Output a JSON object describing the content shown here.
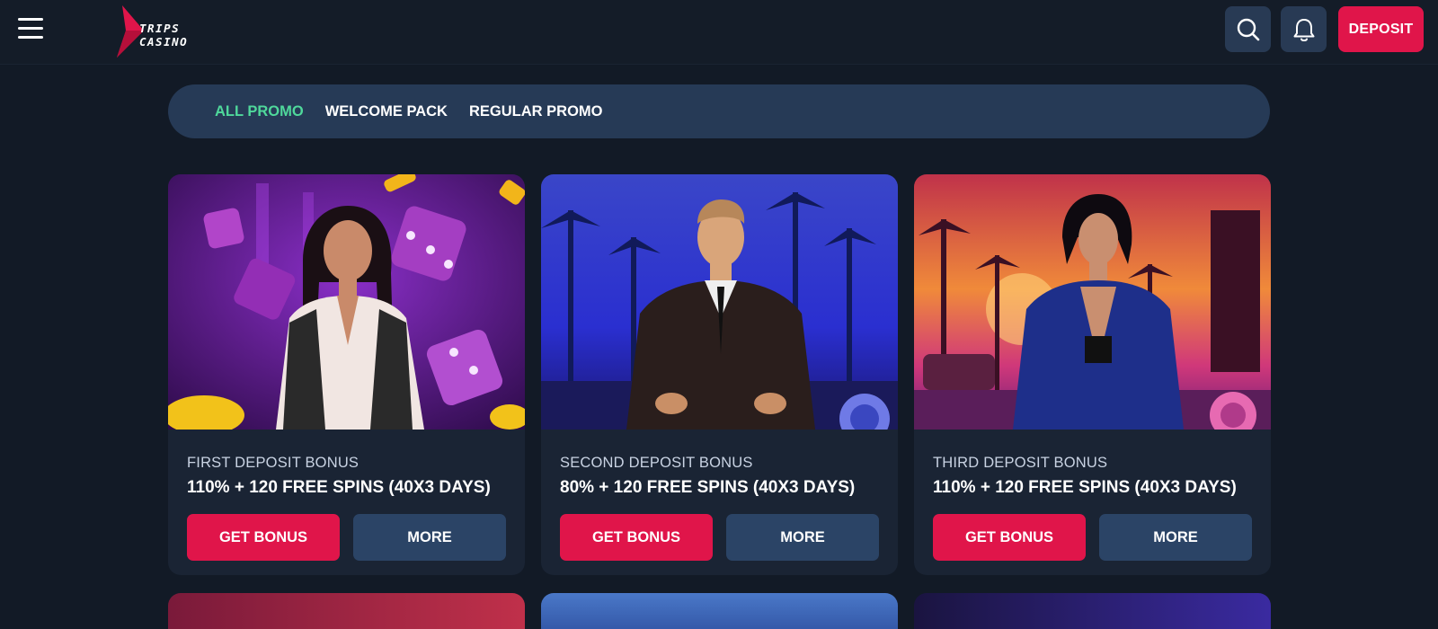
{
  "header": {
    "menu_icon": "hamburger-menu-icon",
    "logo_text_line1": "TRIPS",
    "logo_text_line2": "CASINO",
    "search_icon": "search-icon",
    "bell_icon": "bell-icon",
    "deposit_label": "DEPOSIT"
  },
  "filters": [
    {
      "label": "ALL PROMO",
      "active": true
    },
    {
      "label": "WELCOME PACK",
      "active": false
    },
    {
      "label": "REGULAR PROMO",
      "active": false
    }
  ],
  "cards": [
    {
      "subtitle": "FIRST DEPOSIT BONUS",
      "title": "110% + 120 FREE SPINS (40X3 DAYS)",
      "bonus_label": "GET BONUS",
      "more_label": "MORE"
    },
    {
      "subtitle": "SECOND DEPOSIT BONUS",
      "title": "80% + 120 FREE SPINS (40X3 DAYS)",
      "bonus_label": "GET BONUS",
      "more_label": "MORE"
    },
    {
      "subtitle": "THIRD DEPOSIT BONUS",
      "title": "110% + 120 FREE SPINS (40X3 DAYS)",
      "bonus_label": "GET BONUS",
      "more_label": "MORE"
    }
  ],
  "colors": {
    "background": "#121a26",
    "accent_red": "#e0154a",
    "active_tab": "#4fd89b",
    "button_dark": "#2b4466"
  }
}
